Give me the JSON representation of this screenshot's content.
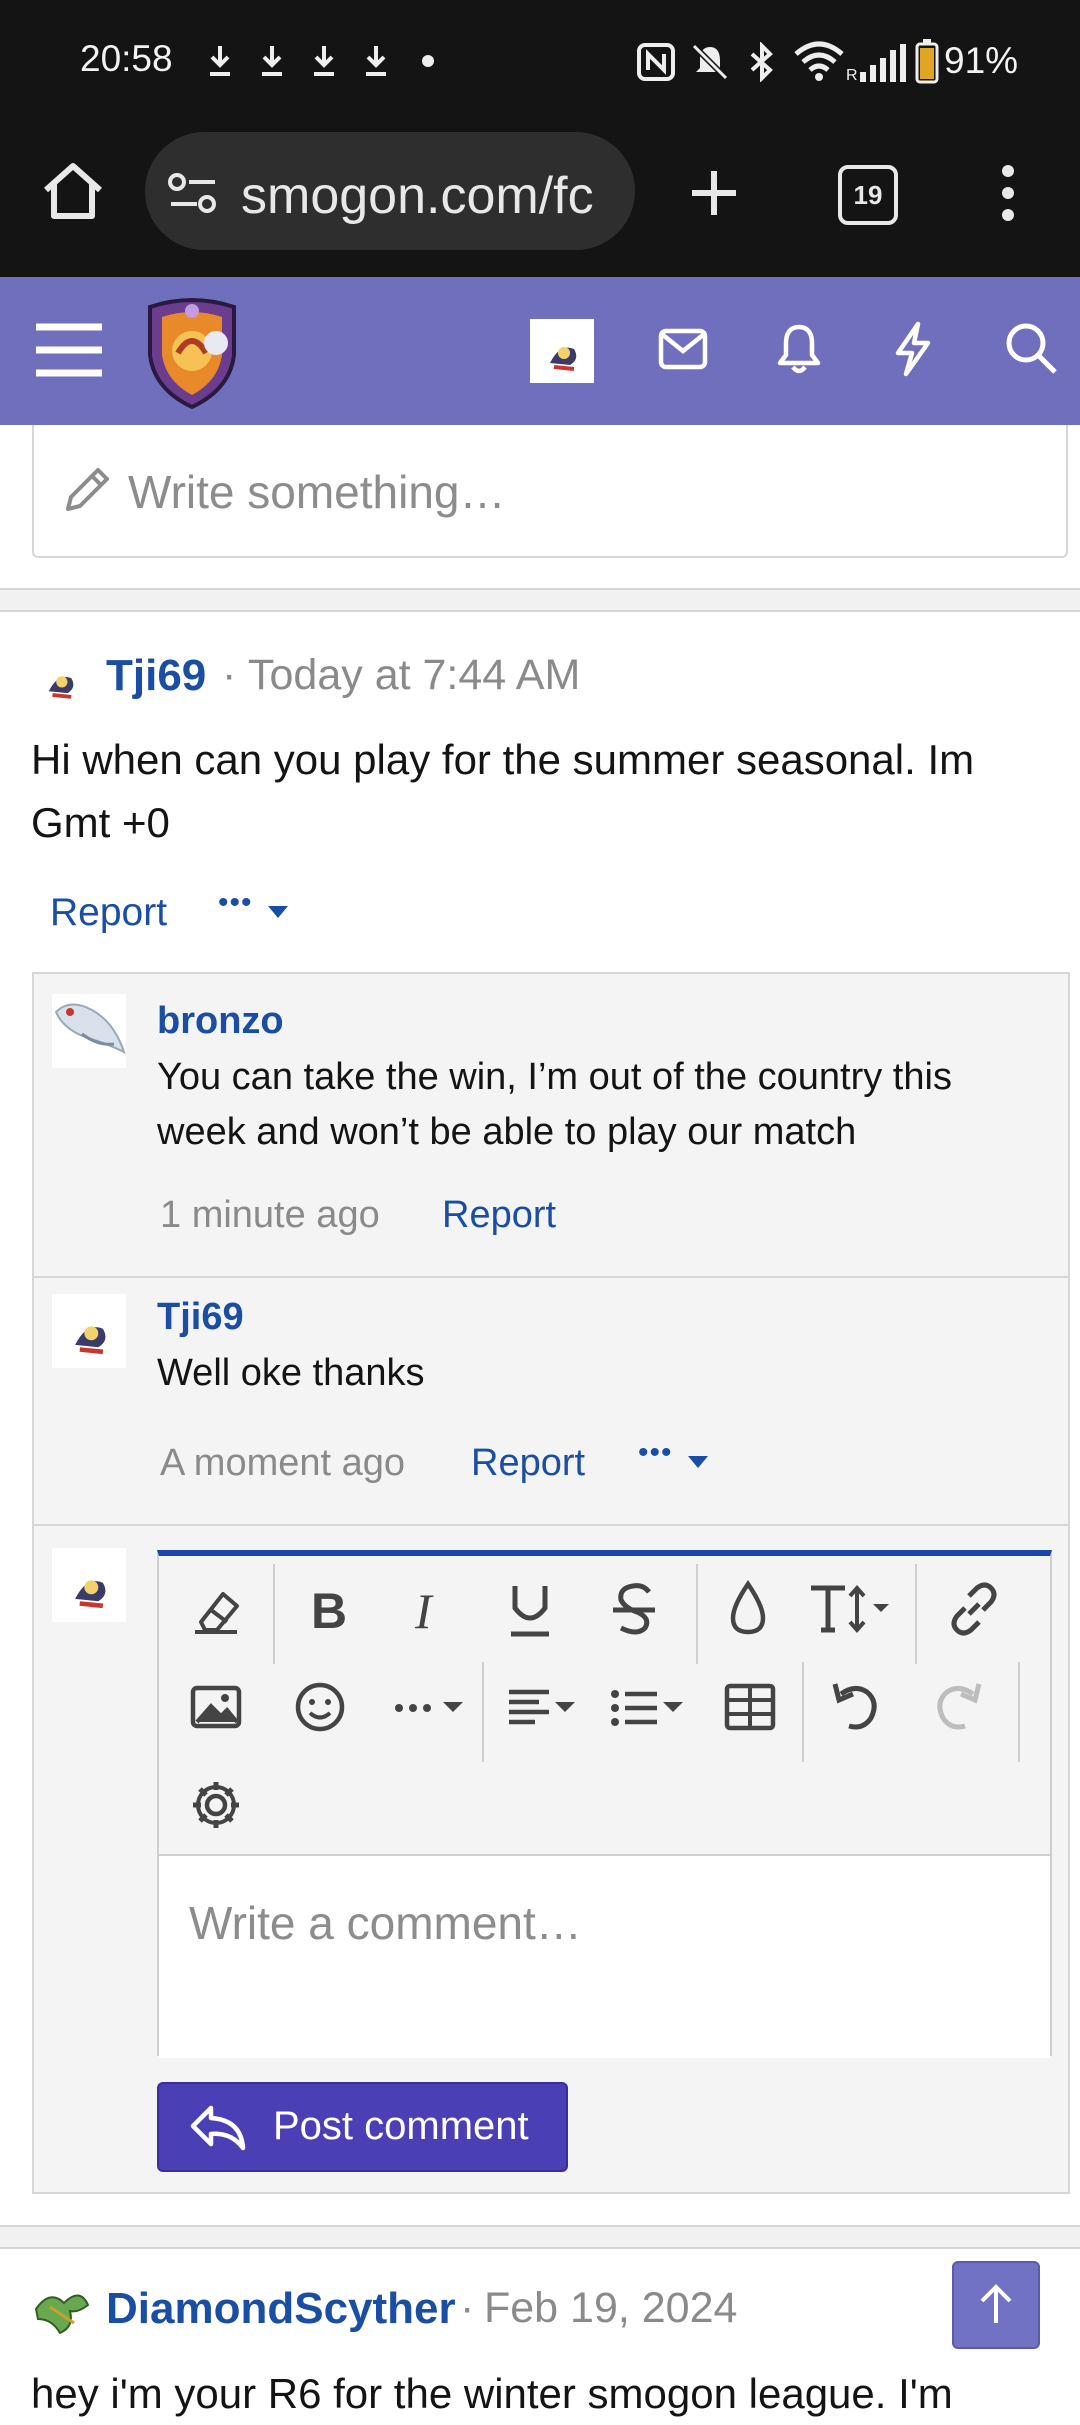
{
  "status_bar": {
    "time": "20:58",
    "battery": "91%"
  },
  "browser": {
    "url": "smogon.com/fc",
    "tab_count": "19"
  },
  "compose": {
    "placeholder": "Write something…"
  },
  "post": {
    "author": "Tji69",
    "separator": "·",
    "timestamp": "Today at 7:44 AM",
    "body_line1": "Hi when can you play for the summer seasonal. Im",
    "body_line2": "Gmt +0",
    "report_label": "Report",
    "more_label": "•••"
  },
  "comments": [
    {
      "author": "bronzo",
      "text_line1": "You can take the win, I’m out of the country this",
      "text_line2": "week and won’t be able to play our match",
      "time": "1 minute ago",
      "report_label": "Report"
    },
    {
      "author": "Tji69",
      "text_line1": "Well oke thanks",
      "time": "A moment ago",
      "report_label": "Report",
      "more_label": "•••"
    }
  ],
  "editor": {
    "placeholder": "Write a comment…",
    "post_button_label": "Post comment"
  },
  "next_post": {
    "author": "DiamondScyther",
    "separator": "·",
    "timestamp": "Feb 19, 2024",
    "body_partial": "hey i'm your R6 for the winter smogon league. I'm"
  },
  "colors": {
    "header_bg": "#6f6fbd",
    "link": "#1a4ea4",
    "button_bg": "#4a3fb5",
    "editor_accent": "#1b45a8"
  }
}
